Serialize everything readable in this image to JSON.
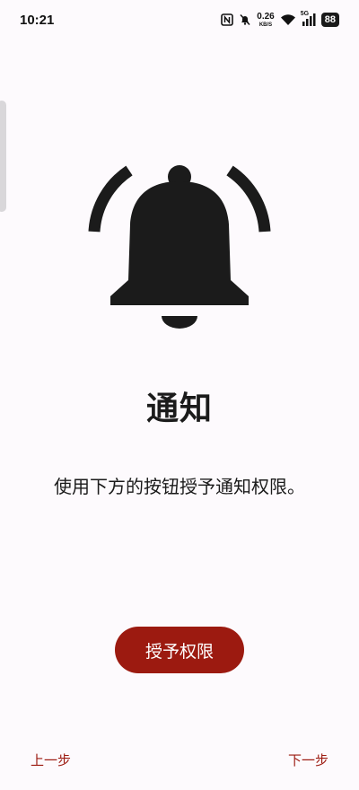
{
  "status_bar": {
    "time": "10:21",
    "net_speed_value": "0.26",
    "net_speed_unit": "KB/S",
    "network_type": "5G",
    "battery": "88",
    "icons": [
      "nfc-icon",
      "mute-icon",
      "wifi-icon",
      "signal-icon",
      "battery-icon"
    ]
  },
  "main": {
    "icon": "bell-icon",
    "title": "通知",
    "description": "使用下方的按钮授予通知权限。"
  },
  "actions": {
    "grant_label": "授予权限"
  },
  "navigation": {
    "prev_label": "上一步",
    "next_label": "下一步"
  },
  "colors": {
    "accent": "#9c1a10",
    "background": "#fdfafd",
    "icon": "#1b1b1b"
  }
}
